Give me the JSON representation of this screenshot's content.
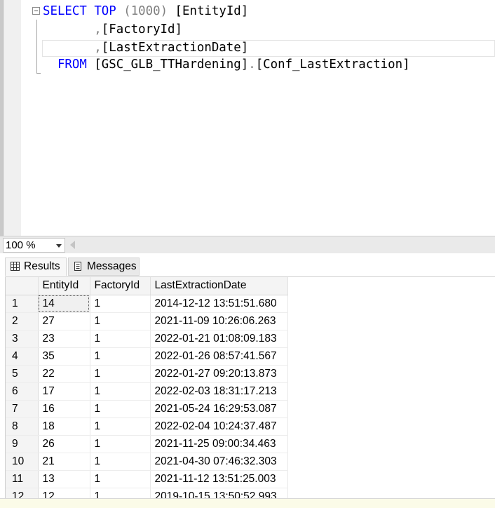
{
  "editor": {
    "lines": [
      {
        "keyword_select": "SELECT",
        "keyword_top": "TOP",
        "paren": "(1000)",
        "column": "[EntityId]"
      },
      {
        "comma": ",",
        "column": "[FactoryId]"
      },
      {
        "comma": ",",
        "column": "[LastExtractionDate]"
      },
      {
        "keyword_from": "FROM",
        "schema": "[GSC_GLB_TTHardening]",
        "dot": ".",
        "table": "[Conf_LastExtraction]"
      }
    ]
  },
  "zoom": {
    "value": "100 %"
  },
  "tabs": [
    {
      "label": "Results",
      "icon": "grid-icon"
    },
    {
      "label": "Messages",
      "icon": "messages-icon"
    }
  ],
  "grid": {
    "columns": [
      "EntityId",
      "FactoryId",
      "LastExtractionDate"
    ],
    "rows": [
      {
        "n": "1",
        "entity": "14",
        "factory": "1",
        "date": "2014-12-12 13:51:51.680"
      },
      {
        "n": "2",
        "entity": "27",
        "factory": "1",
        "date": "2021-11-09 10:26:06.263"
      },
      {
        "n": "3",
        "entity": "23",
        "factory": "1",
        "date": "2022-01-21 01:08:09.183"
      },
      {
        "n": "4",
        "entity": "35",
        "factory": "1",
        "date": "2022-01-26 08:57:41.567"
      },
      {
        "n": "5",
        "entity": "22",
        "factory": "1",
        "date": "2022-01-27 09:20:13.873"
      },
      {
        "n": "6",
        "entity": "17",
        "factory": "1",
        "date": "2022-02-03 18:31:17.213"
      },
      {
        "n": "7",
        "entity": "16",
        "factory": "1",
        "date": "2021-05-24 16:29:53.087"
      },
      {
        "n": "8",
        "entity": "18",
        "factory": "1",
        "date": "2022-02-04 10:24:37.487"
      },
      {
        "n": "9",
        "entity": "26",
        "factory": "1",
        "date": "2021-11-25 09:00:34.463"
      },
      {
        "n": "10",
        "entity": "21",
        "factory": "1",
        "date": "2021-04-30 07:46:32.303"
      },
      {
        "n": "11",
        "entity": "13",
        "factory": "1",
        "date": "2021-11-12 13:51:25.003"
      },
      {
        "n": "12",
        "entity": "12",
        "factory": "1",
        "date": "2019-10-15 13:50:52.993"
      }
    ]
  }
}
